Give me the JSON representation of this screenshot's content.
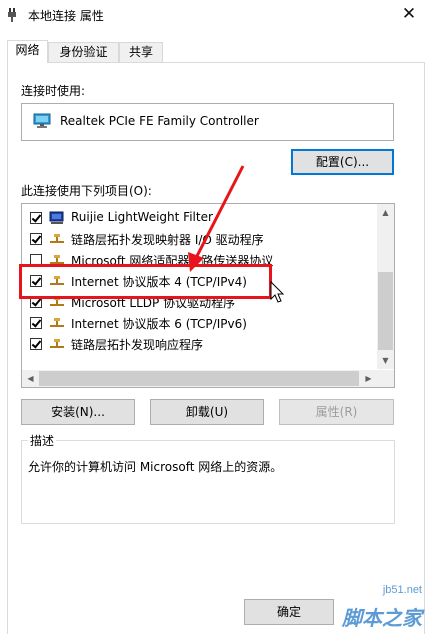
{
  "window": {
    "title": "本地连接 属性",
    "close": "✕"
  },
  "tabs": [
    {
      "label": "网络",
      "active": true
    },
    {
      "label": "身份验证",
      "active": false
    },
    {
      "label": "共享",
      "active": false
    }
  ],
  "connect_using": {
    "label": "连接时使用:",
    "adapter": "Realtek PCIe FE Family Controller",
    "configure_button": "配置(C)..."
  },
  "items": {
    "label": "此连接使用下列项目(O):",
    "rows": [
      {
        "text": "Ruijie LightWeight Filter",
        "checked": true,
        "icon": "filter-icon"
      },
      {
        "text": "链路层拓扑发现映射器 I/O 驱动程序",
        "checked": true,
        "icon": "network-protocol-icon"
      },
      {
        "text": "Microsoft 网络适配器多路传送器协议",
        "checked": false,
        "icon": "network-protocol-icon"
      },
      {
        "text": "Internet 协议版本 4 (TCP/IPv4)",
        "checked": true,
        "icon": "network-protocol-icon"
      },
      {
        "text": "Microsoft LLDP 协议驱动程序",
        "checked": true,
        "icon": "network-protocol-icon"
      },
      {
        "text": "Internet 协议版本 6 (TCP/IPv6)",
        "checked": true,
        "icon": "network-protocol-icon"
      },
      {
        "text": "链路层拓扑发现响应程序",
        "checked": true,
        "icon": "network-protocol-icon"
      }
    ]
  },
  "buttons": {
    "install": "安装(N)...",
    "uninstall": "卸载(U)",
    "properties": "属性(R)",
    "ok": "确定"
  },
  "description": {
    "title": "描述",
    "text": "允许你的计算机访问 Microsoft 网络上的资源。"
  },
  "watermark": {
    "url": "jb51.net",
    "name": "脚本之家"
  },
  "colors": {
    "annotation": "#e8141b",
    "focus": "#0078d7",
    "watermark": "#5c9bd5"
  }
}
